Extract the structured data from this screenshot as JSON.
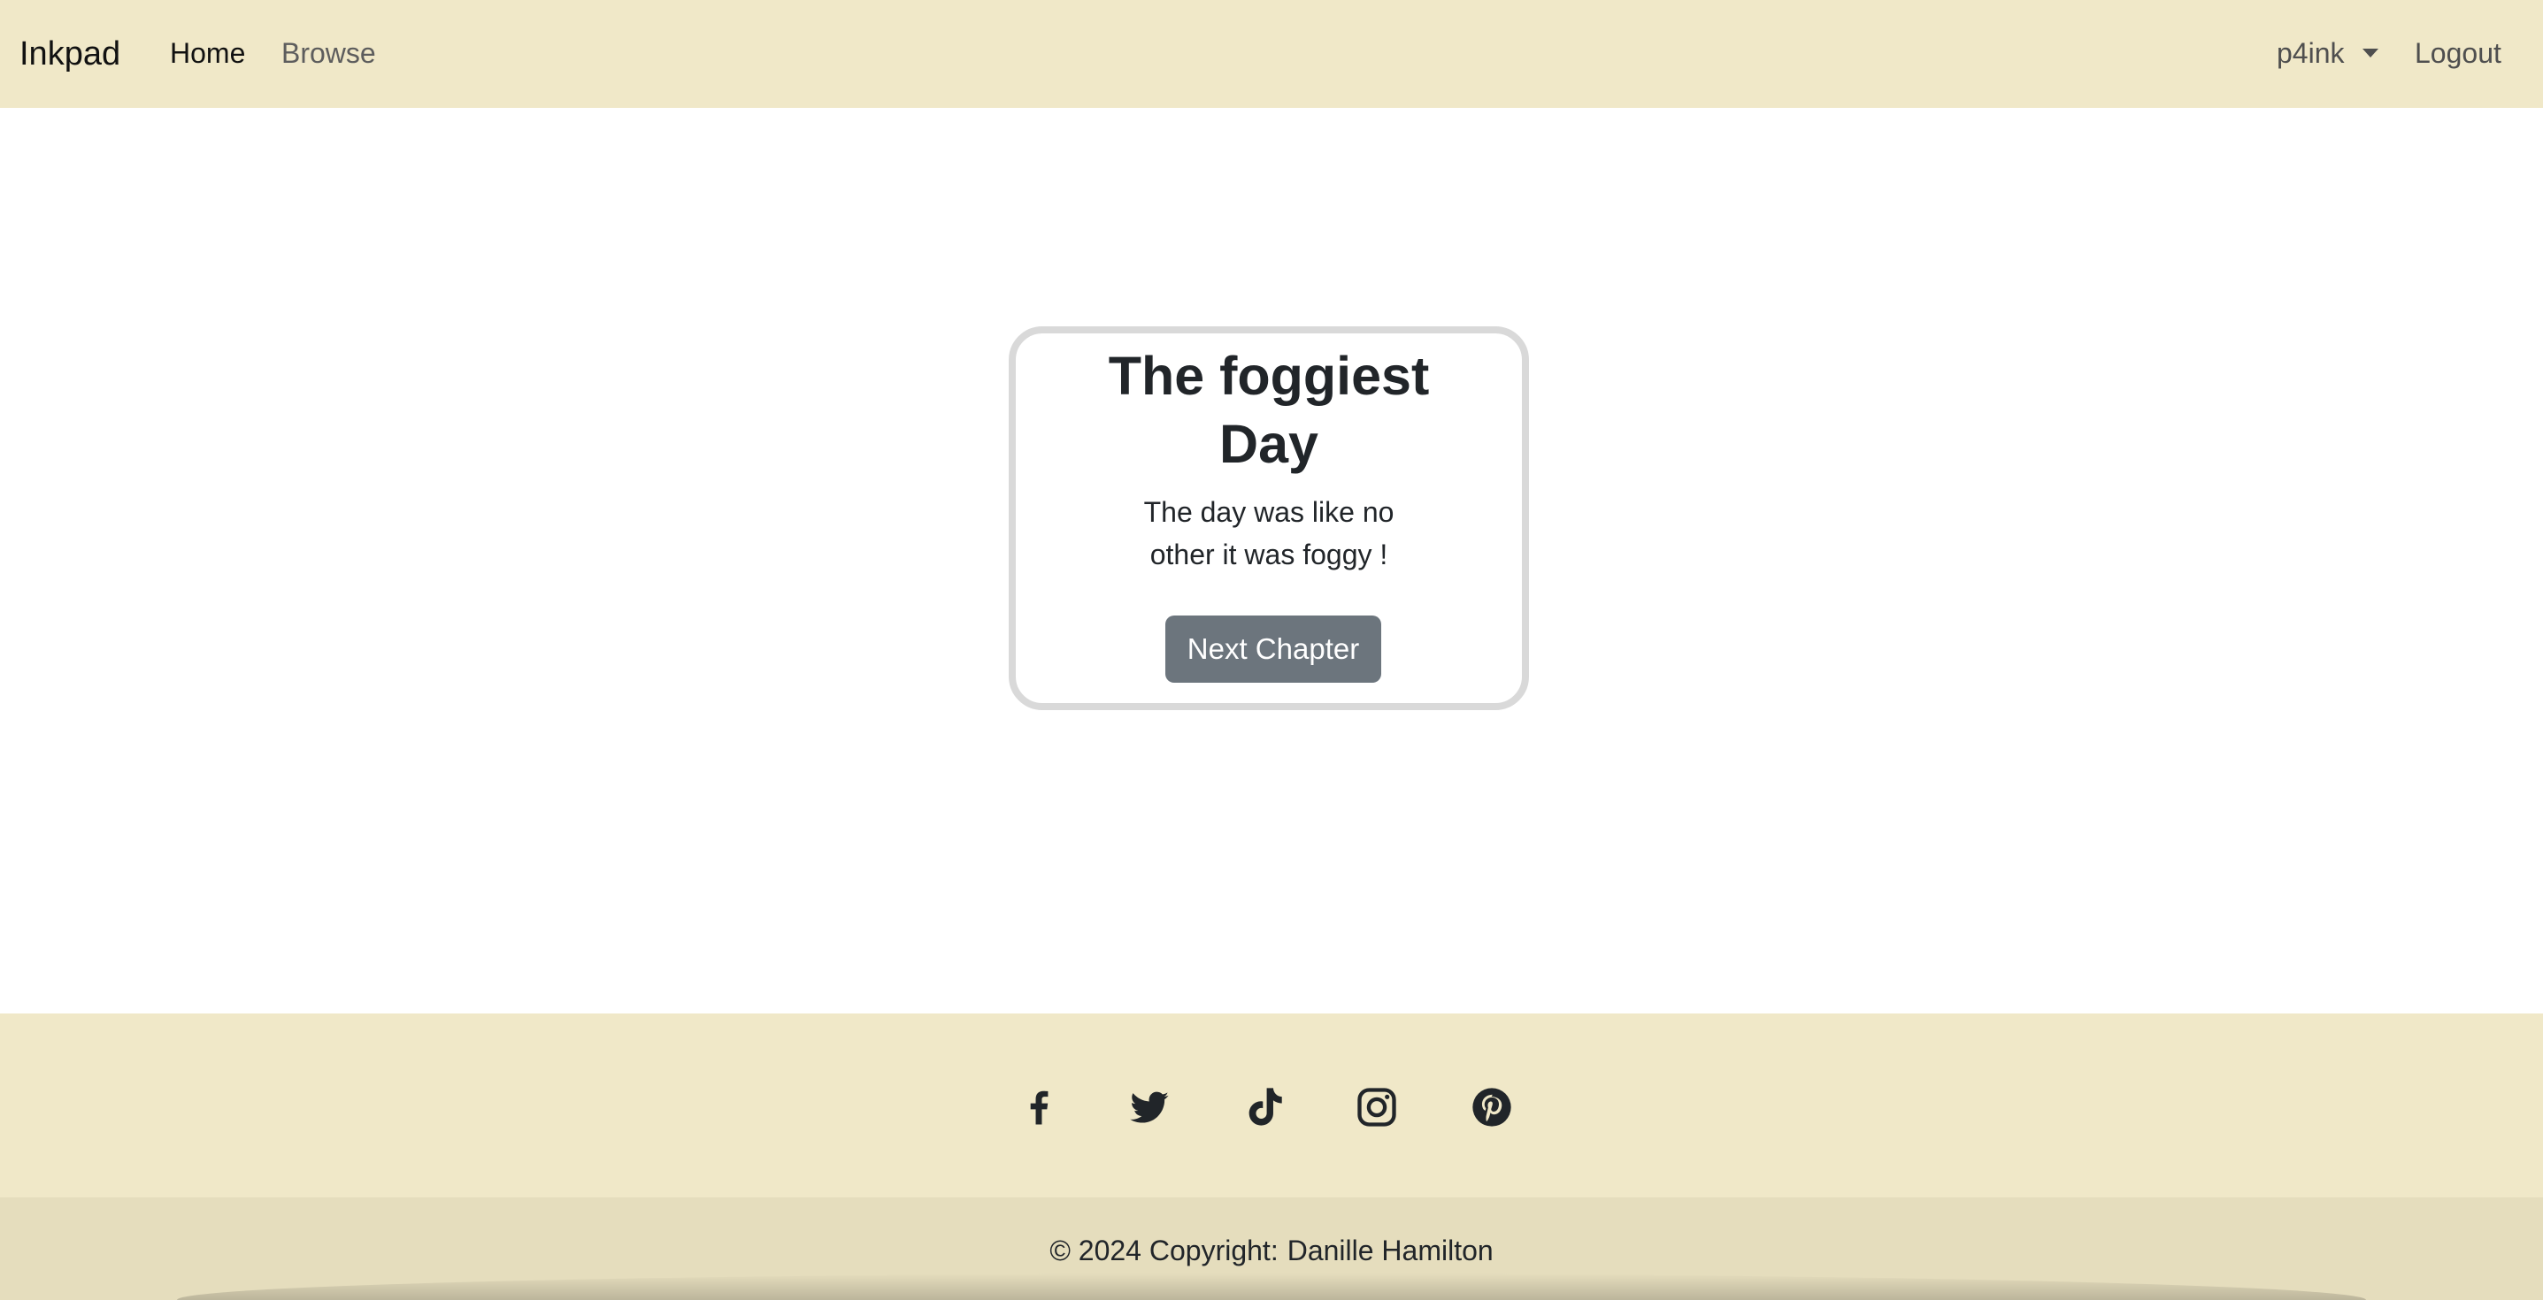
{
  "navbar": {
    "brand": "Inkpad",
    "links": [
      {
        "label": "Home",
        "active": true
      },
      {
        "label": "Browse",
        "active": false
      }
    ],
    "user_menu_label": "p4ink",
    "logout_label": "Logout",
    "background_color": "#f0e8c8"
  },
  "card": {
    "title_lines": [
      "The foggiest",
      "Day"
    ],
    "text_lines": [
      "The day was like no",
      "other it was foggy !"
    ],
    "button_label": "Next Chapter",
    "button_color": "#6c757d",
    "border_color": "#d9d9d9"
  },
  "footer": {
    "social_icons": [
      {
        "name": "facebook-icon"
      },
      {
        "name": "twitter-icon"
      },
      {
        "name": "tiktok-icon"
      },
      {
        "name": "instagram-icon"
      },
      {
        "name": "pinterest-icon"
      }
    ],
    "copyright_label": "© 2024 Copyright:",
    "copyright_author": "Danille Hamilton",
    "background_color": "#f0e8c8",
    "copyright_bar_color": "#e5ddbd"
  }
}
